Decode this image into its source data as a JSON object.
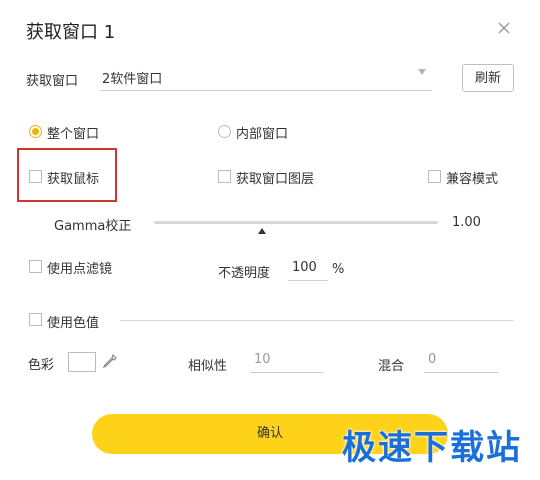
{
  "dialog": {
    "title": "获取窗口 1"
  },
  "capture_window": {
    "label": "获取窗口",
    "selected": "2软件窗口",
    "refresh_label": "刷新"
  },
  "mode": {
    "whole_window": {
      "label": "整个窗口",
      "checked": true
    },
    "inner_window": {
      "label": "内部窗口",
      "checked": false
    }
  },
  "options": {
    "capture_mouse": {
      "label": "获取鼠标",
      "checked": false
    },
    "capture_layers": {
      "label": "获取窗口图层",
      "checked": false
    },
    "compat_mode": {
      "label": "兼容模式",
      "checked": false
    }
  },
  "gamma": {
    "label": "Gamma校正",
    "value": "1.00",
    "level": 0.38
  },
  "filter": {
    "label": "使用点滤镜",
    "checked": false
  },
  "opacity": {
    "label": "不透明度",
    "value": "100",
    "unit": "%"
  },
  "color_value": {
    "label": "使用色值",
    "checked": false
  },
  "color": {
    "label": "色彩",
    "similarity_label": "相似性",
    "similarity_value": "10",
    "blend_label": "混合",
    "blend_value": "0"
  },
  "confirm_label": "确认",
  "watermark": "极速下载站",
  "colors": {
    "accent": "#ffd21a",
    "radio_active": "#f0b400",
    "highlight": "#d0342c",
    "watermark": "#1a6fd8"
  }
}
